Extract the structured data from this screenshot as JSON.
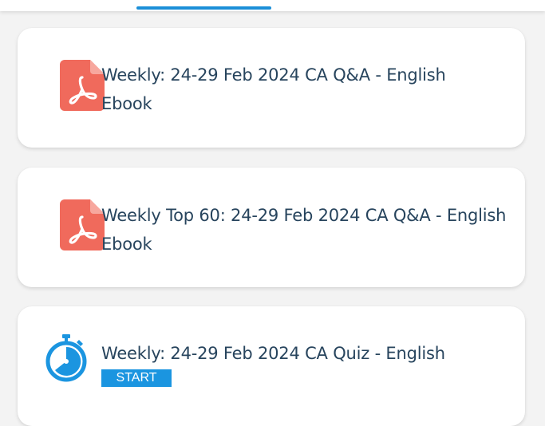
{
  "items": [
    {
      "title_line1": "Weekly: 24-29 Feb 2024 CA Q&A - English",
      "title_line2": "Ebook",
      "icon": "pdf-icon"
    },
    {
      "title_line1": "Weekly Top 60: 24-29 Feb 2024 CA Q&A - English",
      "title_line2": "Ebook",
      "icon": "pdf-icon"
    },
    {
      "title_line1": "Weekly: 24-29 Feb 2024 CA Quiz - English",
      "button_label": "START",
      "icon": "stopwatch-icon"
    }
  ],
  "colors": {
    "accent": "#1b8fd8",
    "pdf_red": "#f06a5c",
    "title_text": "#27445d",
    "background": "#f3f3f3",
    "card": "#ffffff"
  }
}
